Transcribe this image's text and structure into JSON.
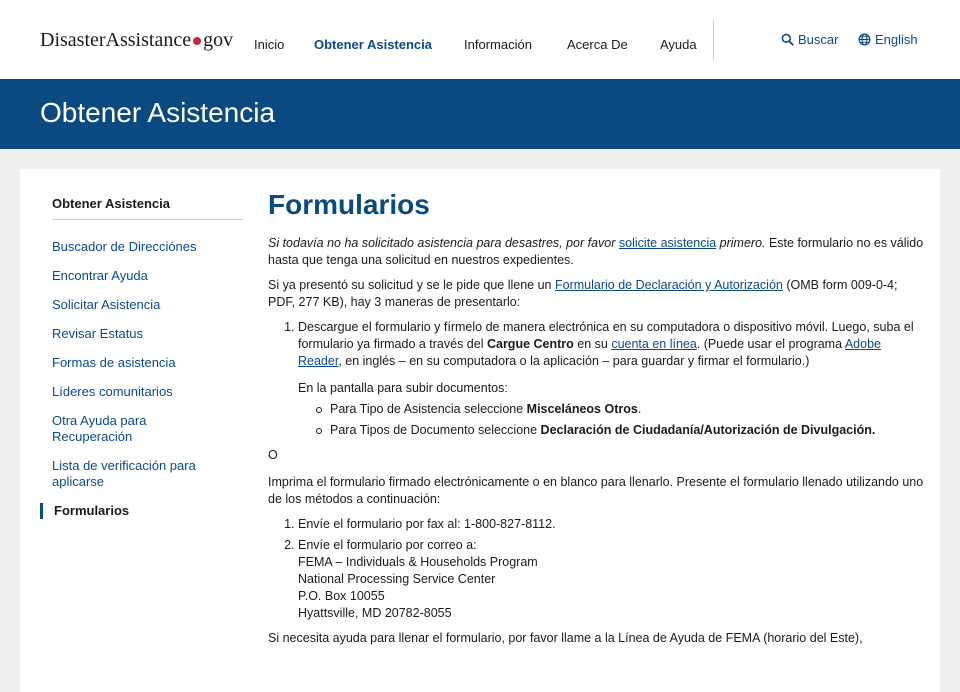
{
  "header": {
    "logo_part1": "Disaster",
    "logo_part2": "Assistance",
    "logo_part3": "gov",
    "nav": [
      {
        "label": "Inicio",
        "active": false
      },
      {
        "label": "Obtener Asistencia",
        "active": true
      },
      {
        "label": "Información",
        "active": false
      },
      {
        "label": "Acerca De",
        "active": false
      },
      {
        "label": "Ayuda",
        "active": false
      }
    ],
    "search_label": "Buscar",
    "language_label": "English"
  },
  "banner": {
    "title": "Obtener Asistencia"
  },
  "sidenav": {
    "title": "Obtener Asistencia",
    "items": [
      {
        "label": "Buscador de Direcciónes"
      },
      {
        "label": "Encontrar Ayuda"
      },
      {
        "label": "Solicitar Asistencia"
      },
      {
        "label": "Revisar Estatus"
      },
      {
        "label": "Formas de asistencia"
      },
      {
        "label": "Líderes comunitarios"
      },
      {
        "label": "Otra Ayuda para Recuperación"
      },
      {
        "label": "Lista de verificación para aplicarse"
      },
      {
        "label": "Formularios",
        "current": true
      }
    ]
  },
  "main": {
    "title": "Formularios",
    "p1_italic_a": "Si todavía no ha solicitado asistencia para desastres, por favor ",
    "p1_link": "solicite asistencia",
    "p1_italic_b": " primero.",
    "p1_rest": " Este formulario no es válido hasta que tenga una solicitud en nuestros expedientes.",
    "p2_a": "Si ya presentó su solicitud y se le pide que llene un ",
    "p2_link": "Formulario de Declaración y Autorización",
    "p2_b": " (OMB form 009-0-4; PDF, 277 KB), hay 3 maneras de presentarlo:",
    "step1_a": "Descargue el formulario y fírmelo de manera electrónica en su computadora o dispositivo móvil. Luego, suba el formulario ya firmado a través del ",
    "step1_bold": "Cargue Centro",
    "step1_b": " en su ",
    "step1_link1": "cuenta en línea",
    "step1_c": ". (Puede usar el programa ",
    "step1_link2": "Adobe Reader",
    "step1_d": ", en inglés – en su computadora o la aplicación – para guardar y firmar el formulario.)",
    "upload_intro": "En la pantalla para subir documentos:",
    "bullet1_a": "Para Tipo de Asistencia seleccione ",
    "bullet1_bold": "Misceláneos Otros",
    "bullet1_b": ".",
    "bullet2_a": "Para Tipos de Documento seleccione ",
    "bullet2_bold": "Declaración de Ciudadanía/Autorización de Divulgación.",
    "or_text": "O",
    "p3": "Imprima el formulario firmado electrónicamente o en blanco para llenarlo. Presente el formulario llenado utilizando uno de los métodos a continuación:",
    "fax_item": "Envíe el formulario por fax al: 1-800-827-8112.",
    "mail_intro": "Envíe el formulario por correo a:",
    "address": [
      "FEMA – Individuals & Households Program",
      "National Processing Service Center",
      "P.O. Box 10055",
      "Hyattsville, MD 20782-8055"
    ],
    "p4": "Si necesita ayuda para llenar el formulario, por favor llame a la Línea de Ayuda de FEMA (horario del Este),"
  },
  "colors": {
    "brand_blue": "#0b4a80",
    "link_blue": "#0b4a8a",
    "logo_dot": "#c6263a",
    "page_bg": "#efefef"
  },
  "icons": {
    "search": "search-icon",
    "language": "globe-icon"
  }
}
